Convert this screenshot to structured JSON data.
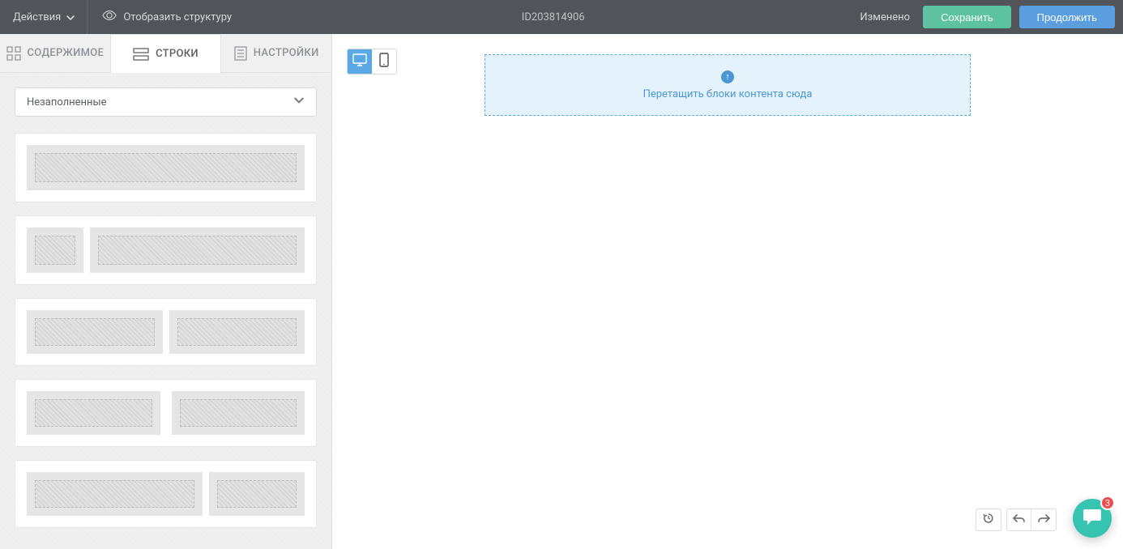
{
  "toolbar": {
    "actions_label": "Действия",
    "show_structure_label": "Отобразить структуру",
    "doc_id": "ID203814906",
    "status": "Изменено",
    "save_label": "Сохранить",
    "continue_label": "Продолжить"
  },
  "tabs": {
    "content": "СОДЕРЖИМОЕ",
    "rows": "СТРОКИ",
    "settings": "НАСТРОЙКИ"
  },
  "filter_select": {
    "selected": "Незаполненные"
  },
  "dropzone": {
    "text": "Перетащить блоки контента сюда"
  },
  "chat": {
    "badge": "3"
  },
  "row_templates": [
    {
      "layout": [
        1
      ]
    },
    {
      "layout": [
        "narrow",
        1
      ]
    },
    {
      "layout": [
        1,
        1
      ]
    },
    {
      "layout": [
        1,
        1
      ],
      "gapVariant": true
    },
    {
      "layout": [
        2,
        1
      ]
    }
  ]
}
